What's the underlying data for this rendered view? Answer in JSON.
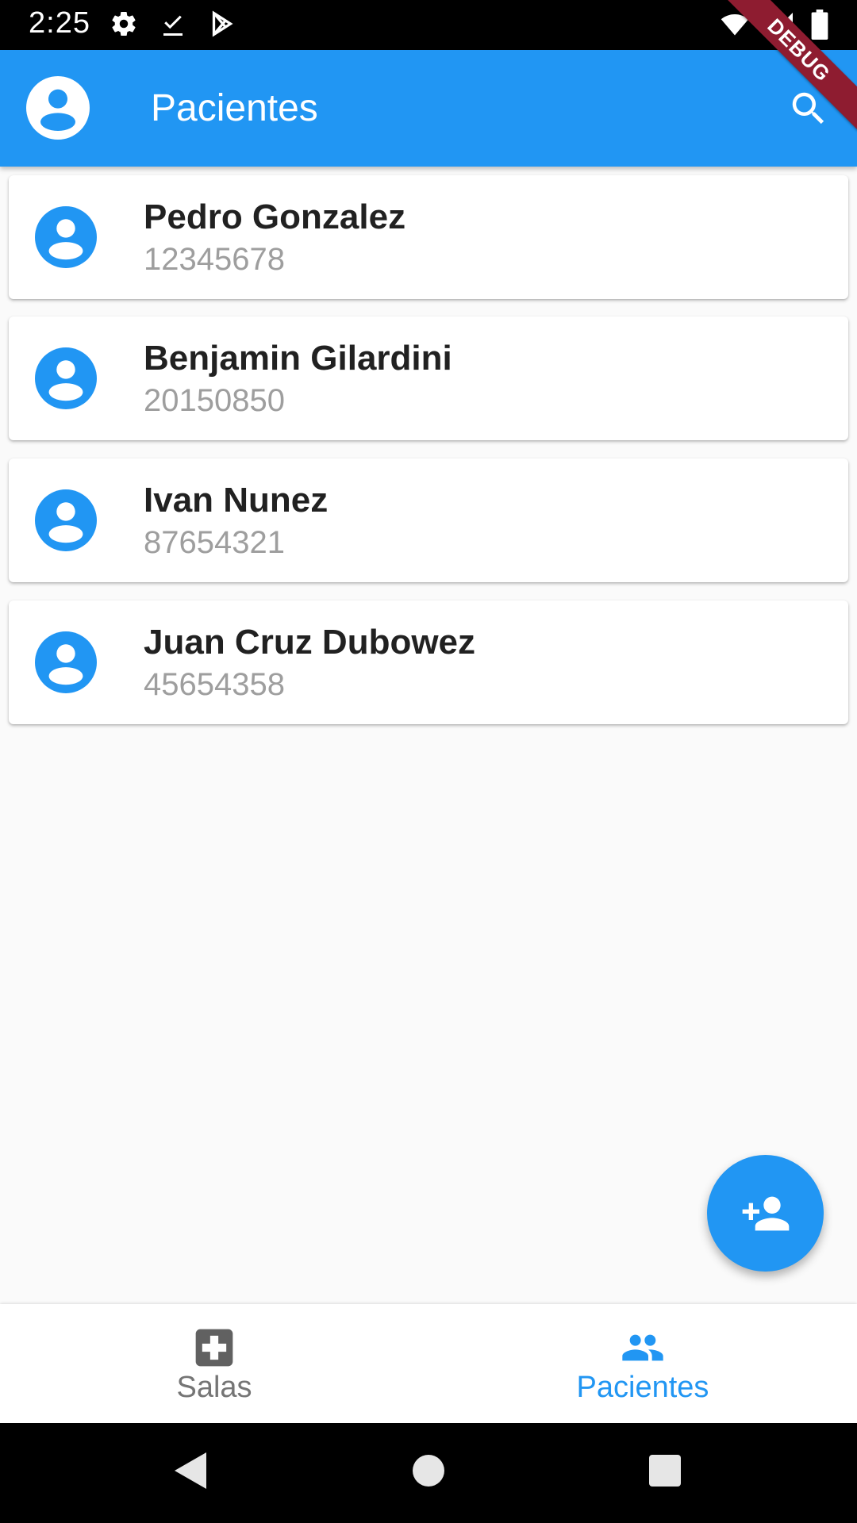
{
  "status_bar": {
    "time": "2:25",
    "left_icons": [
      "gear-icon",
      "check-download-icon",
      "play-store-icon"
    ],
    "right_icons": [
      "wifi-icon",
      "signal-icon",
      "battery-icon"
    ]
  },
  "debug_banner": {
    "label": "DEBUG"
  },
  "app_bar": {
    "title": "Pacientes",
    "leading_icon": "account-circle-icon",
    "action_icon": "search-icon",
    "background": "#2196F3"
  },
  "patients": [
    {
      "name": "Pedro Gonzalez",
      "id": "12345678"
    },
    {
      "name": "Benjamin Gilardini",
      "id": "20150850"
    },
    {
      "name": "Ivan Nunez",
      "id": "87654321"
    },
    {
      "name": "Juan Cruz Dubowez",
      "id": "45654358"
    }
  ],
  "fab": {
    "icon": "person-add-icon"
  },
  "bottom_nav": {
    "items": [
      {
        "label": "Salas",
        "icon": "medical-cross-icon",
        "selected": false
      },
      {
        "label": "Pacientes",
        "icon": "people-icon",
        "selected": true
      }
    ]
  },
  "colors": {
    "primary": "#2196F3",
    "title_text": "#212121",
    "subtitle_text": "#9E9E9E",
    "nav_inactive": "#757575",
    "debug_banner": "#8E1C30"
  }
}
